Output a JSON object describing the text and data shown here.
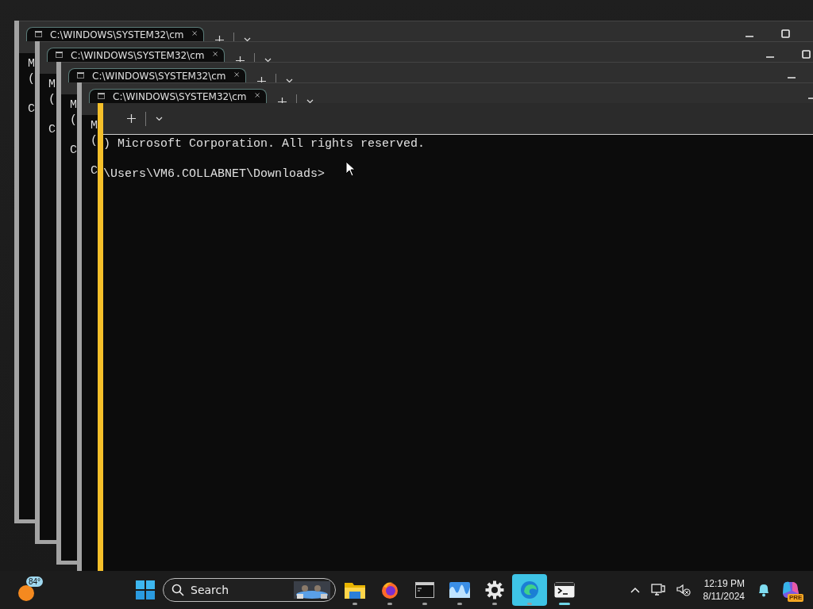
{
  "windows": [
    {
      "title": "C:\\WINDOWS\\SYSTEM32\\cm",
      "lines": [
        "M",
        "(",
        "C"
      ]
    },
    {
      "title": "C:\\WINDOWS\\SYSTEM32\\cm",
      "lines": [
        "M",
        "(",
        "C"
      ]
    },
    {
      "title": "C:\\WINDOWS\\SYSTEM32\\cm",
      "lines": [
        "M",
        "(",
        "C"
      ]
    },
    {
      "title": "C:\\WINDOWS\\SYSTEM32\\cm",
      "lines": [
        "M",
        "(",
        "C"
      ]
    }
  ],
  "front_window": {
    "lines": [
      ") Microsoft Corporation. All rights reserved.",
      "\\Users\\VM6.COLLABNET\\Downloads>"
    ]
  },
  "taskbar": {
    "weather": {
      "temperature": "84°"
    },
    "search": {
      "placeholder": "Search"
    },
    "apps": [
      {
        "kind": "folder",
        "selected": false,
        "active": false
      },
      {
        "kind": "firefox",
        "selected": false,
        "active": false
      },
      {
        "kind": "console",
        "selected": false,
        "active": false
      },
      {
        "kind": "waves",
        "selected": false,
        "active": false
      },
      {
        "kind": "settings",
        "selected": false,
        "active": false
      },
      {
        "kind": "edge",
        "selected": true,
        "active": false
      },
      {
        "kind": "terminal",
        "selected": false,
        "active": true
      }
    ],
    "time": "12:19 PM",
    "date": "8/11/2024",
    "copilot_badge": "PRE"
  }
}
